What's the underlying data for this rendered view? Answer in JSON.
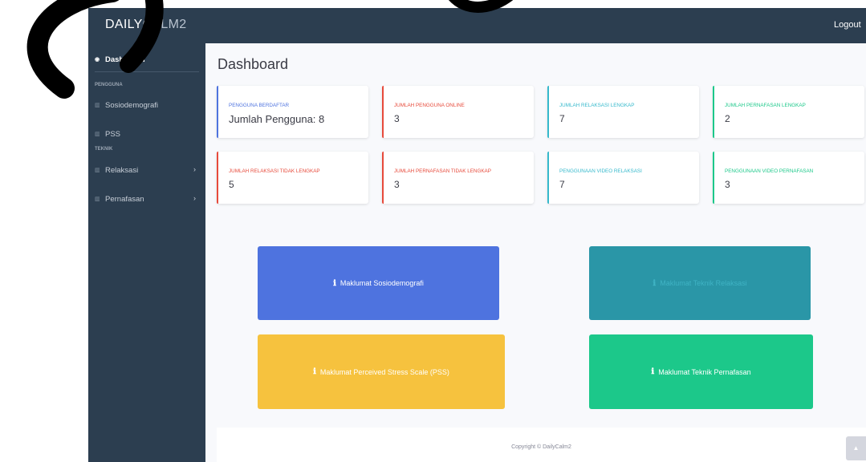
{
  "brand": {
    "part1": "DAILY",
    "part2": "CALM2"
  },
  "topbar": {
    "logout_label": "Logout"
  },
  "sidebar": {
    "dashboard_label": "Dashboard",
    "heading_pengguna": "PENGGUNA",
    "item_sosiodemografi": "Sosiodemografi",
    "item_pss": "PSS",
    "heading_teknik": "TEKNIK",
    "item_relaksasi": "Relaksasi",
    "item_pernafasan": "Pernafasan"
  },
  "page_title": "Dashboard",
  "cards": [
    {
      "label": "PENGGUNA BERDAFTAR",
      "value": "Jumlah Pengguna: 8",
      "accent": "#4e73df"
    },
    {
      "label": "JUMLAH PENGGUNA ONLINE",
      "value": "3",
      "accent": "#e74a3b"
    },
    {
      "label": "JUMLAH RELAKSASI LENGKAP",
      "value": "7",
      "accent": "#36b9cc"
    },
    {
      "label": "JUMLAH PERNAFASAN LENGKAP",
      "value": "2",
      "accent": "#1cc88a"
    },
    {
      "label": "JUMLAH RELAKSASI TIDAK LENGKAP",
      "value": "5",
      "accent": "#e74a3b"
    },
    {
      "label": "JUMLAH PERNAFASAN TIDAK LENGKAP",
      "value": "3",
      "accent": "#e74a3b"
    },
    {
      "label": "PENGGUNAAN VIDEO RELAKSASI",
      "value": "7",
      "accent": "#36b9cc"
    },
    {
      "label": "PENGGUNAAN VIDEO PERNAFASAN",
      "value": "3",
      "accent": "#1cc88a"
    }
  ],
  "buttons": [
    {
      "label": "Maklumat Sosiodemografi",
      "color": "#4e73df"
    },
    {
      "label": "Maklumat Teknik Relaksasi",
      "color": "#2a96a7"
    },
    {
      "label": "Maklumat Perceived Stress Scale (PSS)",
      "color": "#f6c23e"
    },
    {
      "label": "Maklumat Teknik Pernafasan",
      "color": "#1cc88a"
    }
  ],
  "footer": {
    "copyright": "Copyright © DailyCalm2"
  },
  "icons": {
    "info": "ℹ",
    "dashboard": "dashboard-icon",
    "chart": "chart-icon",
    "chevron": "›",
    "scroll_up": "▲"
  }
}
